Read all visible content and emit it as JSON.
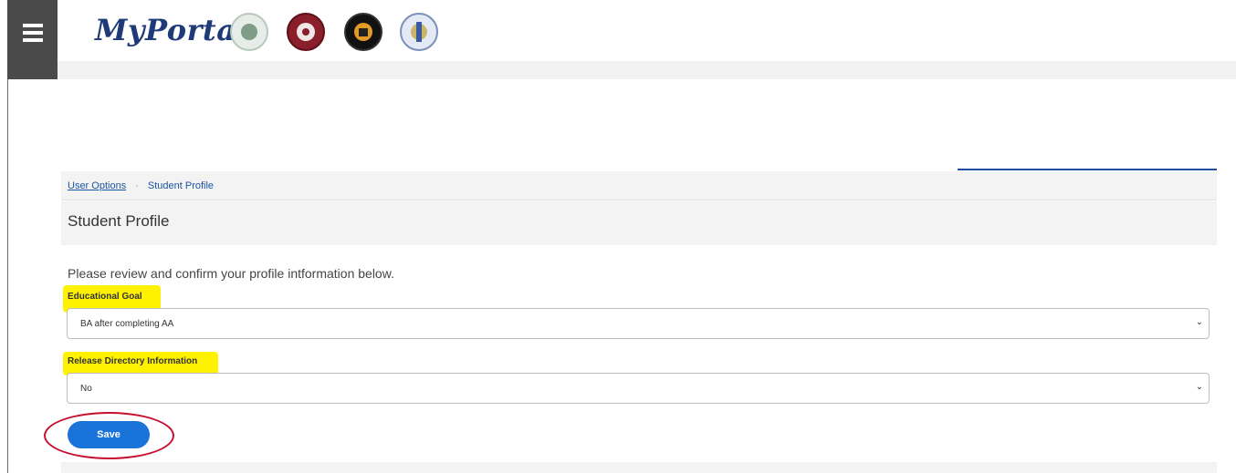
{
  "header": {
    "brand": "MyPortal",
    "menu_icon": "hamburger-menu-icon",
    "seals": [
      "college-seal-1-icon",
      "college-seal-2-icon",
      "college-seal-3-icon",
      "college-seal-4-icon"
    ]
  },
  "breadcrumb": {
    "link": "User Options",
    "separator": "·",
    "current": "Student Profile"
  },
  "page": {
    "title": "Student Profile",
    "intro": "Please review and confirm your profile intformation below."
  },
  "form": {
    "educational_goal": {
      "label": "Educational Goal",
      "value": "BA after completing AA"
    },
    "release_directory": {
      "label": "Release Directory Information",
      "value": "No"
    },
    "save_label": "Save"
  },
  "colors": {
    "brand": "#1f3a78",
    "link": "#1a56a6",
    "button": "#1a73d9",
    "highlight": "#fff200",
    "annotation": "#c8102e"
  }
}
